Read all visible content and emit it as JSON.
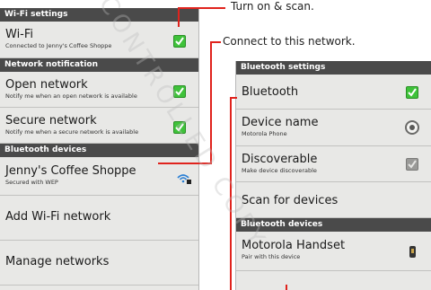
{
  "callouts": {
    "turn_on": "Turn on & scan.",
    "connect": "Connect to this network."
  },
  "wifi_settings": {
    "header": "Wi-Fi settings",
    "wifi": {
      "title": "Wi-Fi",
      "subtitle": "Connected to Jenny's Coffee Shoppe",
      "checked": true
    },
    "network_notification_header": "Network notification",
    "open_network": {
      "title": "Open network",
      "subtitle": "Notify me when an open network is available",
      "checked": true
    },
    "secure_network": {
      "title": "Secure network",
      "subtitle": "Notify me when a secure network is available",
      "checked": true
    },
    "bluetooth_devices_header": "Bluetooth devices",
    "jenny": {
      "title": "Jenny's Coffee Shoppe",
      "subtitle": "Secured with WEP"
    },
    "add_wifi": {
      "title": "Add Wi-Fi network"
    },
    "manage": {
      "title": "Manage networks"
    }
  },
  "bluetooth_settings": {
    "header": "Bluetooth settings",
    "bluetooth": {
      "title": "Bluetooth",
      "checked": true
    },
    "device_name": {
      "title": "Device name",
      "subtitle": "Motorola Phone"
    },
    "discoverable": {
      "title": "Discoverable",
      "subtitle": "Make device discoverable",
      "checked": false
    },
    "scan": {
      "title": "Scan for devices"
    },
    "devices_header": "Bluetooth devices",
    "handset": {
      "title": "Motorola Handset",
      "subtitle": "Pair with this device"
    }
  },
  "colors": {
    "accent_line": "#e0231d",
    "check_on": "#3fc23a",
    "section_bg": "#4a4a4a"
  },
  "icons": [
    "check-icon",
    "radio-icon",
    "wifi-lock-icon",
    "phone-icon"
  ],
  "watermark": {
    "text": "CONTROLLED COPY"
  }
}
